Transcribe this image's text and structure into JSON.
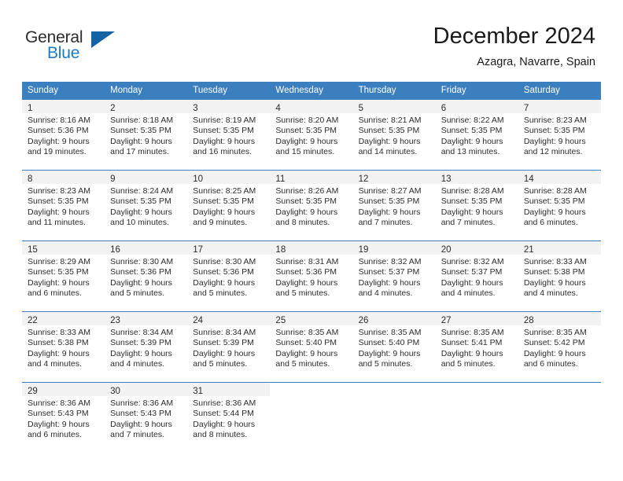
{
  "brand": {
    "name_part1": "General",
    "name_part2": "Blue",
    "triangle_icon": "triangle-logo-icon",
    "color_dark": "#2b2b2b",
    "color_blue": "#1c7ac0",
    "triangle_color": "#1464a5"
  },
  "header": {
    "month_title": "December 2024",
    "location": "Azagra, Navarre, Spain"
  },
  "theme": {
    "header_row_bg": "#3c7fbf",
    "header_row_text": "#ffffff",
    "daynum_band_bg": "#f2f2f2",
    "grid_line": "#3c7fbf",
    "body_text": "#2b2b2b"
  },
  "weekdays": [
    "Sunday",
    "Monday",
    "Tuesday",
    "Wednesday",
    "Thursday",
    "Friday",
    "Saturday"
  ],
  "weeks": [
    [
      {
        "day": "1",
        "sunrise": "Sunrise: 8:16 AM",
        "sunset": "Sunset: 5:36 PM",
        "daylight1": "Daylight: 9 hours",
        "daylight2": "and 19 minutes."
      },
      {
        "day": "2",
        "sunrise": "Sunrise: 8:18 AM",
        "sunset": "Sunset: 5:35 PM",
        "daylight1": "Daylight: 9 hours",
        "daylight2": "and 17 minutes."
      },
      {
        "day": "3",
        "sunrise": "Sunrise: 8:19 AM",
        "sunset": "Sunset: 5:35 PM",
        "daylight1": "Daylight: 9 hours",
        "daylight2": "and 16 minutes."
      },
      {
        "day": "4",
        "sunrise": "Sunrise: 8:20 AM",
        "sunset": "Sunset: 5:35 PM",
        "daylight1": "Daylight: 9 hours",
        "daylight2": "and 15 minutes."
      },
      {
        "day": "5",
        "sunrise": "Sunrise: 8:21 AM",
        "sunset": "Sunset: 5:35 PM",
        "daylight1": "Daylight: 9 hours",
        "daylight2": "and 14 minutes."
      },
      {
        "day": "6",
        "sunrise": "Sunrise: 8:22 AM",
        "sunset": "Sunset: 5:35 PM",
        "daylight1": "Daylight: 9 hours",
        "daylight2": "and 13 minutes."
      },
      {
        "day": "7",
        "sunrise": "Sunrise: 8:23 AM",
        "sunset": "Sunset: 5:35 PM",
        "daylight1": "Daylight: 9 hours",
        "daylight2": "and 12 minutes."
      }
    ],
    [
      {
        "day": "8",
        "sunrise": "Sunrise: 8:23 AM",
        "sunset": "Sunset: 5:35 PM",
        "daylight1": "Daylight: 9 hours",
        "daylight2": "and 11 minutes."
      },
      {
        "day": "9",
        "sunrise": "Sunrise: 8:24 AM",
        "sunset": "Sunset: 5:35 PM",
        "daylight1": "Daylight: 9 hours",
        "daylight2": "and 10 minutes."
      },
      {
        "day": "10",
        "sunrise": "Sunrise: 8:25 AM",
        "sunset": "Sunset: 5:35 PM",
        "daylight1": "Daylight: 9 hours",
        "daylight2": "and 9 minutes."
      },
      {
        "day": "11",
        "sunrise": "Sunrise: 8:26 AM",
        "sunset": "Sunset: 5:35 PM",
        "daylight1": "Daylight: 9 hours",
        "daylight2": "and 8 minutes."
      },
      {
        "day": "12",
        "sunrise": "Sunrise: 8:27 AM",
        "sunset": "Sunset: 5:35 PM",
        "daylight1": "Daylight: 9 hours",
        "daylight2": "and 7 minutes."
      },
      {
        "day": "13",
        "sunrise": "Sunrise: 8:28 AM",
        "sunset": "Sunset: 5:35 PM",
        "daylight1": "Daylight: 9 hours",
        "daylight2": "and 7 minutes."
      },
      {
        "day": "14",
        "sunrise": "Sunrise: 8:28 AM",
        "sunset": "Sunset: 5:35 PM",
        "daylight1": "Daylight: 9 hours",
        "daylight2": "and 6 minutes."
      }
    ],
    [
      {
        "day": "15",
        "sunrise": "Sunrise: 8:29 AM",
        "sunset": "Sunset: 5:35 PM",
        "daylight1": "Daylight: 9 hours",
        "daylight2": "and 6 minutes."
      },
      {
        "day": "16",
        "sunrise": "Sunrise: 8:30 AM",
        "sunset": "Sunset: 5:36 PM",
        "daylight1": "Daylight: 9 hours",
        "daylight2": "and 5 minutes."
      },
      {
        "day": "17",
        "sunrise": "Sunrise: 8:30 AM",
        "sunset": "Sunset: 5:36 PM",
        "daylight1": "Daylight: 9 hours",
        "daylight2": "and 5 minutes."
      },
      {
        "day": "18",
        "sunrise": "Sunrise: 8:31 AM",
        "sunset": "Sunset: 5:36 PM",
        "daylight1": "Daylight: 9 hours",
        "daylight2": "and 5 minutes."
      },
      {
        "day": "19",
        "sunrise": "Sunrise: 8:32 AM",
        "sunset": "Sunset: 5:37 PM",
        "daylight1": "Daylight: 9 hours",
        "daylight2": "and 4 minutes."
      },
      {
        "day": "20",
        "sunrise": "Sunrise: 8:32 AM",
        "sunset": "Sunset: 5:37 PM",
        "daylight1": "Daylight: 9 hours",
        "daylight2": "and 4 minutes."
      },
      {
        "day": "21",
        "sunrise": "Sunrise: 8:33 AM",
        "sunset": "Sunset: 5:38 PM",
        "daylight1": "Daylight: 9 hours",
        "daylight2": "and 4 minutes."
      }
    ],
    [
      {
        "day": "22",
        "sunrise": "Sunrise: 8:33 AM",
        "sunset": "Sunset: 5:38 PM",
        "daylight1": "Daylight: 9 hours",
        "daylight2": "and 4 minutes."
      },
      {
        "day": "23",
        "sunrise": "Sunrise: 8:34 AM",
        "sunset": "Sunset: 5:39 PM",
        "daylight1": "Daylight: 9 hours",
        "daylight2": "and 4 minutes."
      },
      {
        "day": "24",
        "sunrise": "Sunrise: 8:34 AM",
        "sunset": "Sunset: 5:39 PM",
        "daylight1": "Daylight: 9 hours",
        "daylight2": "and 5 minutes."
      },
      {
        "day": "25",
        "sunrise": "Sunrise: 8:35 AM",
        "sunset": "Sunset: 5:40 PM",
        "daylight1": "Daylight: 9 hours",
        "daylight2": "and 5 minutes."
      },
      {
        "day": "26",
        "sunrise": "Sunrise: 8:35 AM",
        "sunset": "Sunset: 5:40 PM",
        "daylight1": "Daylight: 9 hours",
        "daylight2": "and 5 minutes."
      },
      {
        "day": "27",
        "sunrise": "Sunrise: 8:35 AM",
        "sunset": "Sunset: 5:41 PM",
        "daylight1": "Daylight: 9 hours",
        "daylight2": "and 5 minutes."
      },
      {
        "day": "28",
        "sunrise": "Sunrise: 8:35 AM",
        "sunset": "Sunset: 5:42 PM",
        "daylight1": "Daylight: 9 hours",
        "daylight2": "and 6 minutes."
      }
    ],
    [
      {
        "day": "29",
        "sunrise": "Sunrise: 8:36 AM",
        "sunset": "Sunset: 5:43 PM",
        "daylight1": "Daylight: 9 hours",
        "daylight2": "and 6 minutes."
      },
      {
        "day": "30",
        "sunrise": "Sunrise: 8:36 AM",
        "sunset": "Sunset: 5:43 PM",
        "daylight1": "Daylight: 9 hours",
        "daylight2": "and 7 minutes."
      },
      {
        "day": "31",
        "sunrise": "Sunrise: 8:36 AM",
        "sunset": "Sunset: 5:44 PM",
        "daylight1": "Daylight: 9 hours",
        "daylight2": "and 8 minutes."
      },
      {
        "day": "",
        "sunrise": "",
        "sunset": "",
        "daylight1": "",
        "daylight2": ""
      },
      {
        "day": "",
        "sunrise": "",
        "sunset": "",
        "daylight1": "",
        "daylight2": ""
      },
      {
        "day": "",
        "sunrise": "",
        "sunset": "",
        "daylight1": "",
        "daylight2": ""
      },
      {
        "day": "",
        "sunrise": "",
        "sunset": "",
        "daylight1": "",
        "daylight2": ""
      }
    ]
  ]
}
